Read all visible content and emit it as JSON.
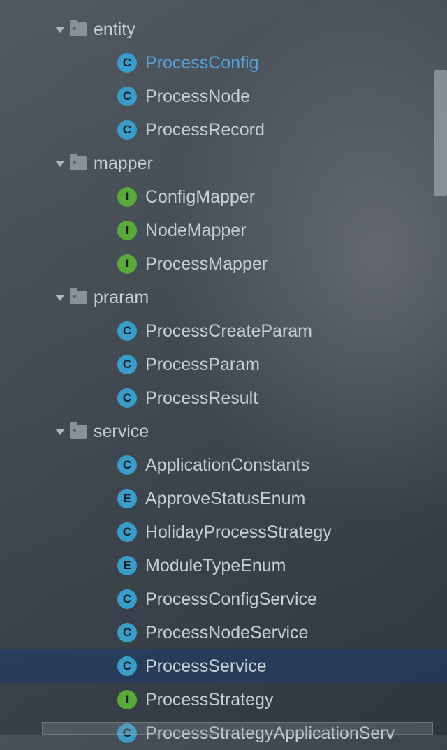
{
  "tree": [
    {
      "type": "folder",
      "label": "entity",
      "indent": 1,
      "expanded": true,
      "highlight": false
    },
    {
      "type": "class",
      "badge": "C",
      "badgeClass": "badge-c",
      "label": "ProcessConfig",
      "indent": 2,
      "highlight": true
    },
    {
      "type": "class",
      "badge": "C",
      "badgeClass": "badge-c",
      "label": "ProcessNode",
      "indent": 2,
      "highlight": false
    },
    {
      "type": "class",
      "badge": "C",
      "badgeClass": "badge-c",
      "label": "ProcessRecord",
      "indent": 2,
      "highlight": false
    },
    {
      "type": "folder",
      "label": "mapper",
      "indent": 1,
      "expanded": true,
      "highlight": false
    },
    {
      "type": "interface",
      "badge": "I",
      "badgeClass": "badge-i",
      "label": "ConfigMapper",
      "indent": 2,
      "highlight": false
    },
    {
      "type": "interface",
      "badge": "I",
      "badgeClass": "badge-i",
      "label": "NodeMapper",
      "indent": 2,
      "highlight": false
    },
    {
      "type": "interface",
      "badge": "I",
      "badgeClass": "badge-i",
      "label": "ProcessMapper",
      "indent": 2,
      "highlight": false
    },
    {
      "type": "folder",
      "label": "praram",
      "indent": 1,
      "expanded": true,
      "highlight": false
    },
    {
      "type": "class",
      "badge": "C",
      "badgeClass": "badge-c",
      "label": "ProcessCreateParam",
      "indent": 2,
      "highlight": false
    },
    {
      "type": "class",
      "badge": "C",
      "badgeClass": "badge-c",
      "label": "ProcessParam",
      "indent": 2,
      "highlight": false
    },
    {
      "type": "class",
      "badge": "C",
      "badgeClass": "badge-c",
      "label": "ProcessResult",
      "indent": 2,
      "highlight": false
    },
    {
      "type": "folder",
      "label": "service",
      "indent": 1,
      "expanded": true,
      "highlight": false
    },
    {
      "type": "class",
      "badge": "C",
      "badgeClass": "badge-c",
      "label": "ApplicationConstants",
      "indent": 2,
      "highlight": false
    },
    {
      "type": "enum",
      "badge": "E",
      "badgeClass": "badge-e",
      "label": "ApproveStatusEnum",
      "indent": 2,
      "highlight": false
    },
    {
      "type": "class",
      "badge": "C",
      "badgeClass": "badge-c",
      "label": "HolidayProcessStrategy",
      "indent": 2,
      "highlight": false
    },
    {
      "type": "enum",
      "badge": "E",
      "badgeClass": "badge-e",
      "label": "ModuleTypeEnum",
      "indent": 2,
      "highlight": false
    },
    {
      "type": "class",
      "badge": "C",
      "badgeClass": "badge-c",
      "label": "ProcessConfigService",
      "indent": 2,
      "highlight": false
    },
    {
      "type": "class",
      "badge": "C",
      "badgeClass": "badge-c",
      "label": "ProcessNodeService",
      "indent": 2,
      "highlight": false
    },
    {
      "type": "class",
      "badge": "C",
      "badgeClass": "badge-c",
      "label": "ProcessService",
      "indent": 2,
      "highlight": false,
      "selected": true
    },
    {
      "type": "interface",
      "badge": "I",
      "badgeClass": "badge-i",
      "label": "ProcessStrategy",
      "indent": 2,
      "highlight": false
    },
    {
      "type": "class",
      "badge": "C",
      "badgeClass": "badge-c",
      "label": "ProcessStrategyApplicationServ",
      "indent": 2,
      "highlight": false
    }
  ]
}
